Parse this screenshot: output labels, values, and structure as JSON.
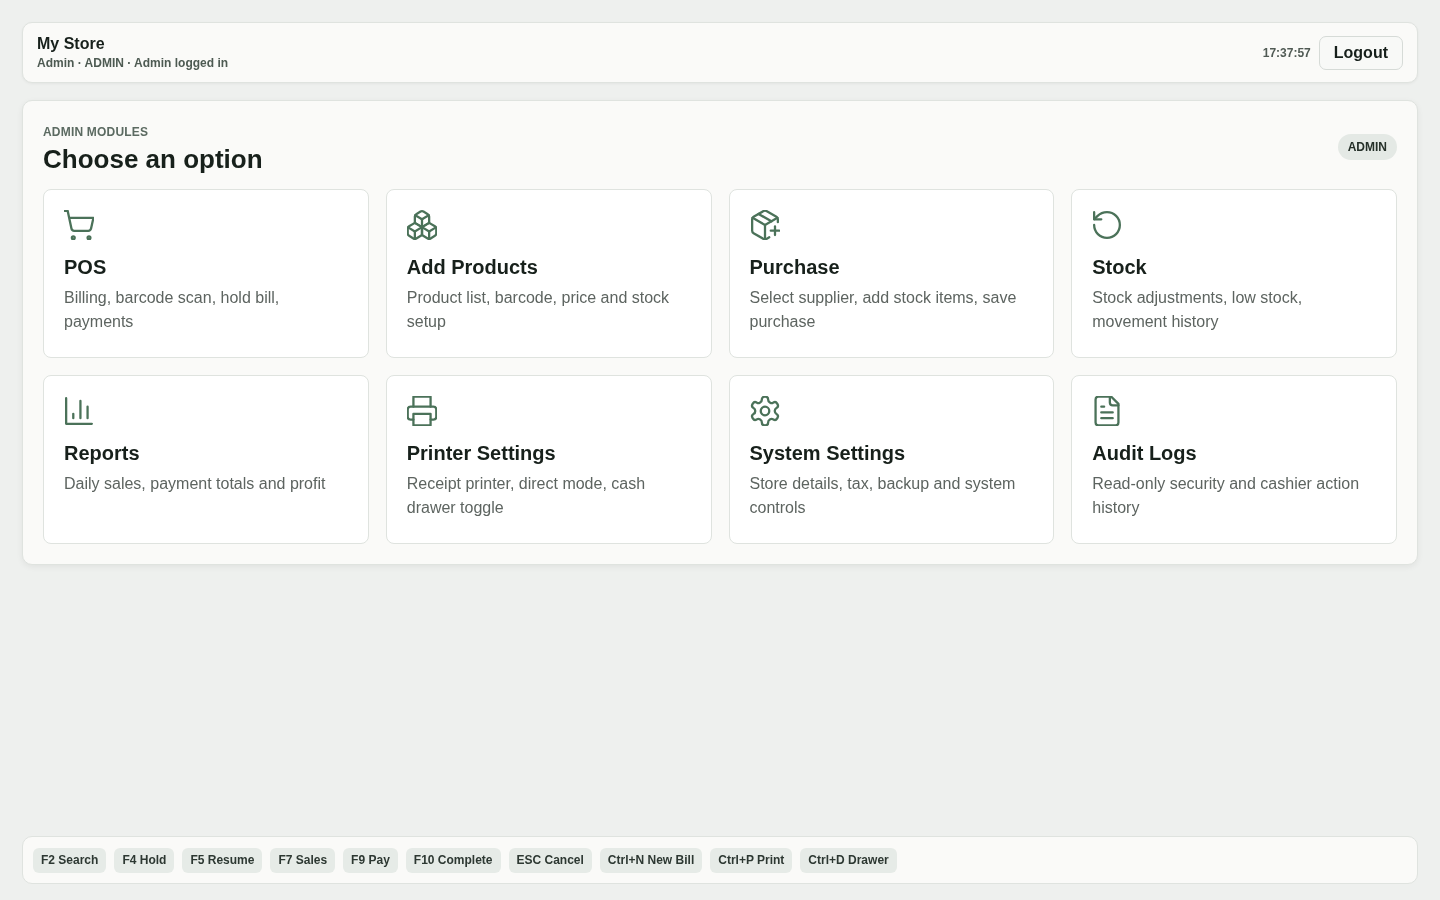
{
  "header": {
    "store_name": "My Store",
    "subtitle": "Admin · ADMIN · Admin logged in",
    "time": "17:37:57",
    "logout_button": "Logout"
  },
  "panel": {
    "eyebrow": "ADMIN MODULES",
    "title": "Choose an option",
    "role_badge": "ADMIN",
    "modules": [
      {
        "title": "POS",
        "description": "Billing, barcode scan, hold bill, payments"
      },
      {
        "title": "Add Products",
        "description": "Product list, barcode, price and stock setup"
      },
      {
        "title": "Purchase",
        "description": "Select supplier, add stock items, save purchase"
      },
      {
        "title": "Stock",
        "description": "Stock adjustments, low stock, movement history"
      },
      {
        "title": "Reports",
        "description": "Daily sales, payment totals and profit"
      },
      {
        "title": "Printer Settings",
        "description": "Receipt printer, direct mode, cash drawer toggle"
      },
      {
        "title": "System Settings",
        "description": "Store details, tax, backup and system controls"
      },
      {
        "title": "Audit Logs",
        "description": "Read-only security and cashier action history"
      }
    ]
  },
  "shortcuts": [
    "F2 Search",
    "F4 Hold",
    "F5 Resume",
    "F7 Sales",
    "F9 Pay",
    "F10 Complete",
    "ESC Cancel",
    "Ctrl+N New Bill",
    "Ctrl+P Print",
    "Ctrl+D Drawer"
  ]
}
